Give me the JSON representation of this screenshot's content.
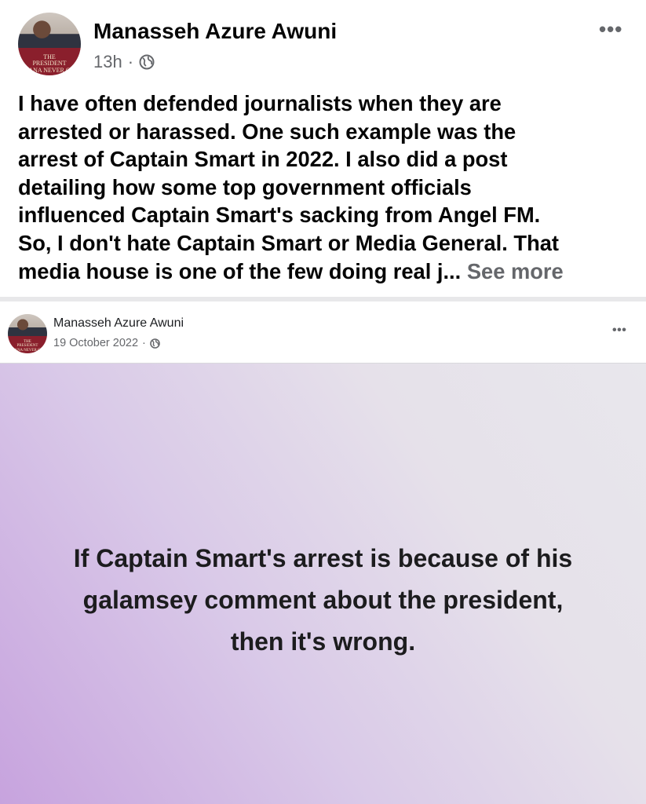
{
  "post": {
    "author": "Manasseh Azure Awuni",
    "time": "13h",
    "separator": "·",
    "privacy_icon": "globe-icon",
    "more_icon": "•••",
    "avatar_banner": [
      "THE",
      "PRESIDENT",
      "HANA NEVER GO"
    ],
    "body_lines": [
      "I have often defended journalists when they are",
      "arrested or harassed. One such example was the",
      "arrest of Captain Smart in 2022. I also did a post",
      "detailing how some top government officials",
      "influenced Captain Smart's sacking from Angel FM.",
      "So, I don't hate Captain Smart or Media General. That",
      "media house is one of the few doing real j..."
    ],
    "see_more": "See more"
  },
  "shared_post": {
    "author": "Manasseh Azure Awuni",
    "date": "19 October 2022",
    "separator": "·",
    "privacy_icon": "globe-icon",
    "more_icon": "•••",
    "avatar_banner": [
      "THE",
      "PRESIDENT",
      "HANA NEVER GO"
    ],
    "card_lines": [
      "If Captain Smart's arrest is because of his",
      "galamsey comment about the president,",
      "then it's wrong."
    ]
  },
  "colors": {
    "text_primary": "#050505",
    "text_secondary": "#65676b",
    "banner_red": "#8a1f2c",
    "card_purple": "#c7a3de",
    "card_grey": "#e8e7ec"
  }
}
